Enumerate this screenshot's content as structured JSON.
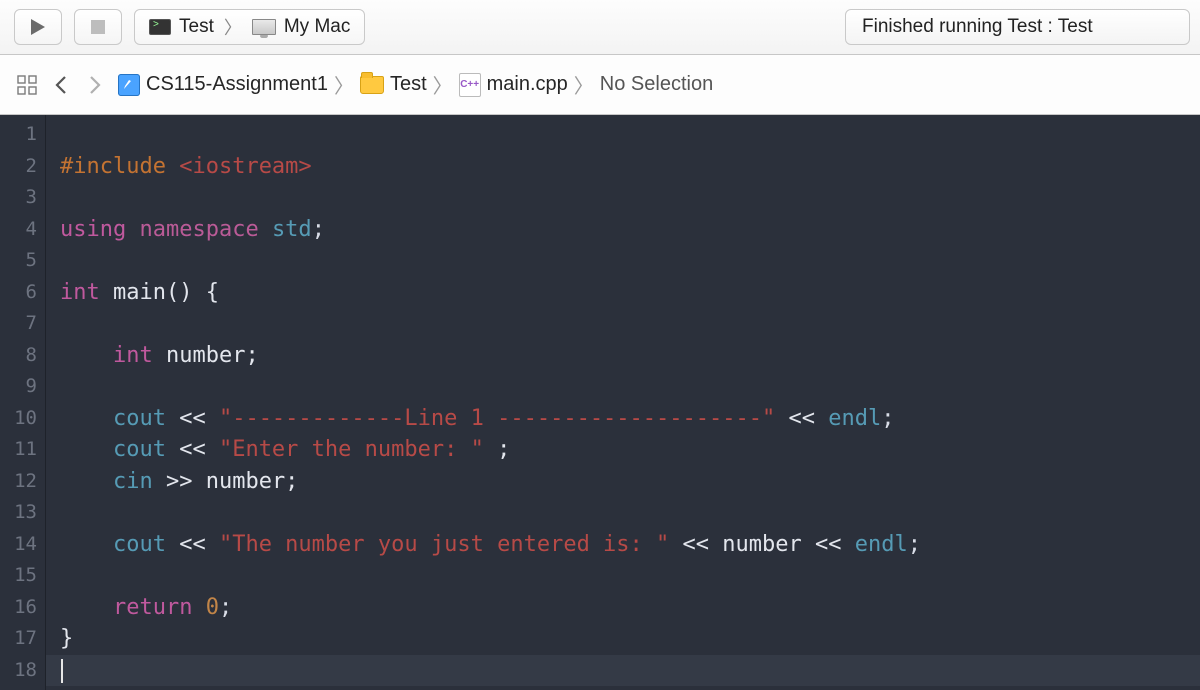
{
  "toolbar": {
    "scheme_name": "Test",
    "destination": "My Mac",
    "status_text": "Finished running Test : Test"
  },
  "breadcrumb": {
    "project": "CS115-Assignment1",
    "folder": "Test",
    "file": "main.cpp",
    "cpp_badge": "C++",
    "selection": "No Selection"
  },
  "editor": {
    "line_count": 18,
    "current_line": 18,
    "lines": [
      {
        "n": 1,
        "tokens": []
      },
      {
        "n": 2,
        "tokens": [
          {
            "c": "tok-pre",
            "t": "#include "
          },
          {
            "c": "tok-hdr",
            "t": "<iostream>"
          }
        ]
      },
      {
        "n": 3,
        "tokens": []
      },
      {
        "n": 4,
        "tokens": [
          {
            "c": "tok-key1",
            "t": "using "
          },
          {
            "c": "tok-key2",
            "t": "namespace "
          },
          {
            "c": "tok-type",
            "t": "std"
          },
          {
            "c": "tok-punc",
            "t": ";"
          }
        ]
      },
      {
        "n": 5,
        "tokens": []
      },
      {
        "n": 6,
        "tokens": [
          {
            "c": "tok-key1",
            "t": "int "
          },
          {
            "c": "tok-plain",
            "t": "main() {"
          }
        ]
      },
      {
        "n": 7,
        "tokens": []
      },
      {
        "n": 8,
        "tokens": [
          {
            "c": "tok-plain",
            "t": "    "
          },
          {
            "c": "tok-key1",
            "t": "int "
          },
          {
            "c": "tok-plain",
            "t": "number;"
          }
        ]
      },
      {
        "n": 9,
        "tokens": []
      },
      {
        "n": 10,
        "tokens": [
          {
            "c": "tok-plain",
            "t": "    "
          },
          {
            "c": "tok-type",
            "t": "cout"
          },
          {
            "c": "tok-plain",
            "t": " << "
          },
          {
            "c": "tok-str",
            "t": "\"-------------Line 1 --------------------\""
          },
          {
            "c": "tok-plain",
            "t": " << "
          },
          {
            "c": "tok-type",
            "t": "endl"
          },
          {
            "c": "tok-punc",
            "t": ";"
          }
        ]
      },
      {
        "n": 11,
        "tokens": [
          {
            "c": "tok-plain",
            "t": "    "
          },
          {
            "c": "tok-type",
            "t": "cout"
          },
          {
            "c": "tok-plain",
            "t": " << "
          },
          {
            "c": "tok-str",
            "t": "\"Enter the number: \""
          },
          {
            "c": "tok-plain",
            "t": " ;"
          }
        ]
      },
      {
        "n": 12,
        "tokens": [
          {
            "c": "tok-plain",
            "t": "    "
          },
          {
            "c": "tok-type",
            "t": "cin"
          },
          {
            "c": "tok-plain",
            "t": " >> number;"
          }
        ]
      },
      {
        "n": 13,
        "tokens": []
      },
      {
        "n": 14,
        "tokens": [
          {
            "c": "tok-plain",
            "t": "    "
          },
          {
            "c": "tok-type",
            "t": "cout"
          },
          {
            "c": "tok-plain",
            "t": " << "
          },
          {
            "c": "tok-str",
            "t": "\"The number you just entered is: \""
          },
          {
            "c": "tok-plain",
            "t": " << number << "
          },
          {
            "c": "tok-type",
            "t": "endl"
          },
          {
            "c": "tok-punc",
            "t": ";"
          }
        ]
      },
      {
        "n": 15,
        "tokens": []
      },
      {
        "n": 16,
        "tokens": [
          {
            "c": "tok-plain",
            "t": "    "
          },
          {
            "c": "tok-key1",
            "t": "return "
          },
          {
            "c": "tok-num",
            "t": "0"
          },
          {
            "c": "tok-punc",
            "t": ";"
          }
        ]
      },
      {
        "n": 17,
        "tokens": [
          {
            "c": "tok-plain",
            "t": "}"
          }
        ]
      },
      {
        "n": 18,
        "tokens": [],
        "cursor": true
      }
    ]
  }
}
